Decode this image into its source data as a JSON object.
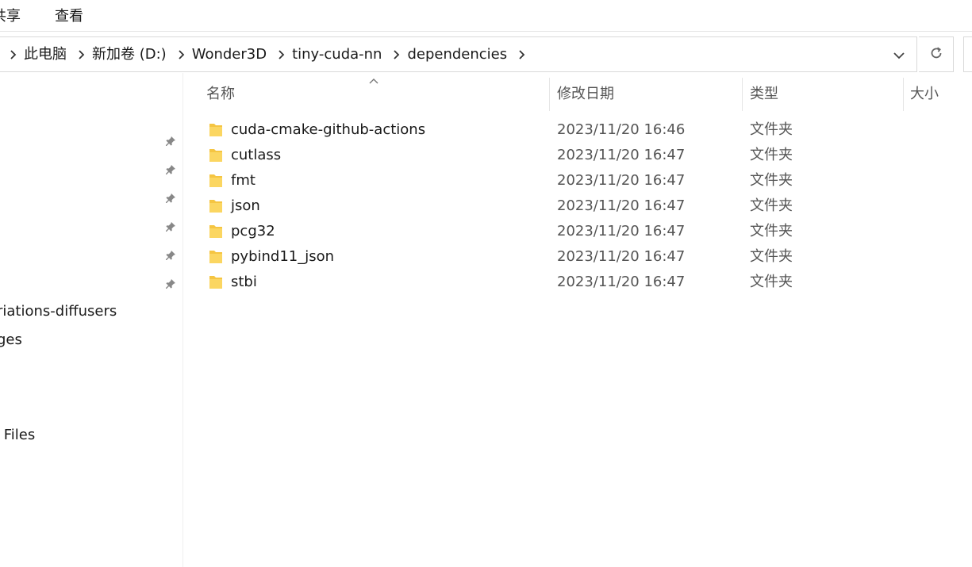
{
  "ribbon": {
    "tabs": [
      {
        "label": "共享"
      },
      {
        "label": "查看"
      }
    ]
  },
  "address": {
    "crumbs": [
      "此电脑",
      "新加卷 (D:)",
      "Wonder3D",
      "tiny-cuda-nn",
      "dependencies"
    ]
  },
  "nav": {
    "items": [
      {
        "label": "riations-diffusers"
      },
      {
        "label": "ges"
      },
      {
        "label": "l Files"
      }
    ],
    "pinned_count": 6
  },
  "columns": {
    "name": "名称",
    "date": "修改日期",
    "type": "类型",
    "size": "大小"
  },
  "files": [
    {
      "name": "cuda-cmake-github-actions",
      "date": "2023/11/20 16:46",
      "type": "文件夹"
    },
    {
      "name": "cutlass",
      "date": "2023/11/20 16:47",
      "type": "文件夹"
    },
    {
      "name": "fmt",
      "date": "2023/11/20 16:47",
      "type": "文件夹"
    },
    {
      "name": "json",
      "date": "2023/11/20 16:47",
      "type": "文件夹"
    },
    {
      "name": "pcg32",
      "date": "2023/11/20 16:47",
      "type": "文件夹"
    },
    {
      "name": "pybind11_json",
      "date": "2023/11/20 16:47",
      "type": "文件夹"
    },
    {
      "name": "stbi",
      "date": "2023/11/20 16:47",
      "type": "文件夹"
    }
  ],
  "colors": {
    "folder": "#F5C542",
    "folder_dark": "#E0A92A",
    "border": "#D9D9D9",
    "muted_text": "#555555"
  }
}
